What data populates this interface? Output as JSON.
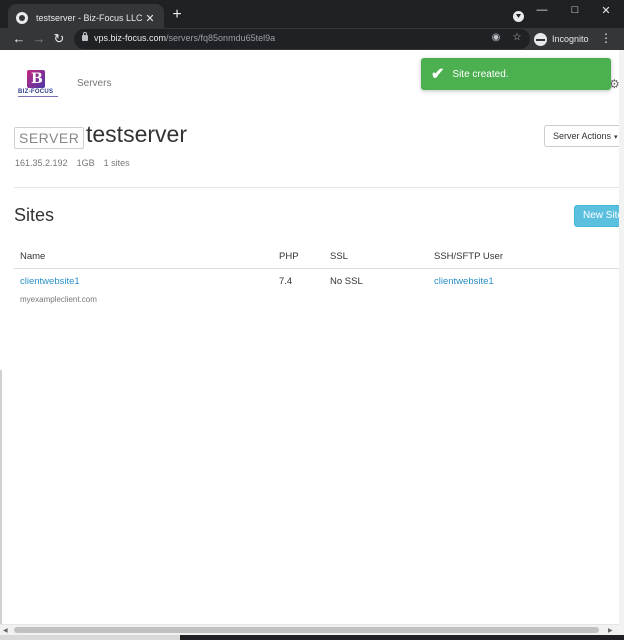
{
  "browser": {
    "tab_title": "testserver - Biz-Focus LLC",
    "tab_close_icon": "✕",
    "new_tab_icon": "+",
    "minimize_icon": "—",
    "maximize_icon": "□",
    "close_icon": "✕",
    "back_icon": "←",
    "forward_icon": "→",
    "reload_icon": "↻",
    "url_host": "vps.biz-focus.com",
    "url_path": "/servers/fq85onmdu65tel9a",
    "eye_off_icon": "◉",
    "star_icon": "☆",
    "incognito_label": "Incognito",
    "menu_icon": "⋮"
  },
  "header": {
    "logo_text": "BIZ-FOCUS",
    "nav_servers": "Servers"
  },
  "toast": {
    "check_icon": "✔",
    "message": "Site created."
  },
  "server": {
    "badge": "SERVER",
    "name": "testserver",
    "actions_label": "Server Actions",
    "actions_caret": "▾",
    "gear_icon": "⚙",
    "ip": "161.35.2.192",
    "memory": "1GB",
    "sites_count": "1 sites"
  },
  "sites": {
    "title": "Sites",
    "new_site_label": "New Site",
    "columns": [
      "Name",
      "PHP",
      "SSL",
      "SSH/SFTP User"
    ],
    "rows": [
      {
        "name": "clientwebsite1",
        "php": "7.4",
        "ssl": "No SSL",
        "user": "clientwebsite1",
        "domain": "myexampleclient.com"
      }
    ]
  },
  "scrollbar": {
    "left_arrow": "◀",
    "right_arrow": "▶"
  },
  "colors": {
    "toast_bg": "#4caf50",
    "link": "#2a8fc7",
    "new_site_bg": "#5bc0de",
    "chrome_dark": "#202124",
    "chrome_toolbar": "#35363a"
  }
}
